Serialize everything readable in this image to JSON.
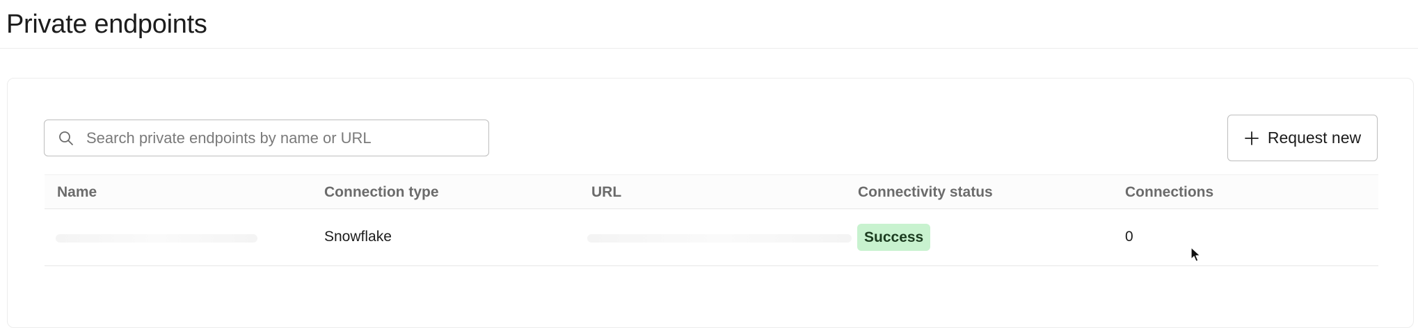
{
  "page": {
    "title": "Private endpoints"
  },
  "search": {
    "placeholder": "Search private endpoints by name or URL",
    "value": "",
    "icon": "search-icon"
  },
  "toolbar": {
    "request_label": "Request new",
    "request_icon": "plus-icon"
  },
  "table": {
    "columns": [
      "Name",
      "Connection type",
      "URL",
      "Connectivity status",
      "Connections"
    ],
    "rows": [
      {
        "name": "",
        "connection_type": "Snowflake",
        "url": "",
        "status": "Success",
        "connections": "0"
      }
    ]
  },
  "colors": {
    "success_badge_bg": "#c8f2cf",
    "success_badge_text": "#1b3b1f",
    "border": "#bdbdbd"
  }
}
